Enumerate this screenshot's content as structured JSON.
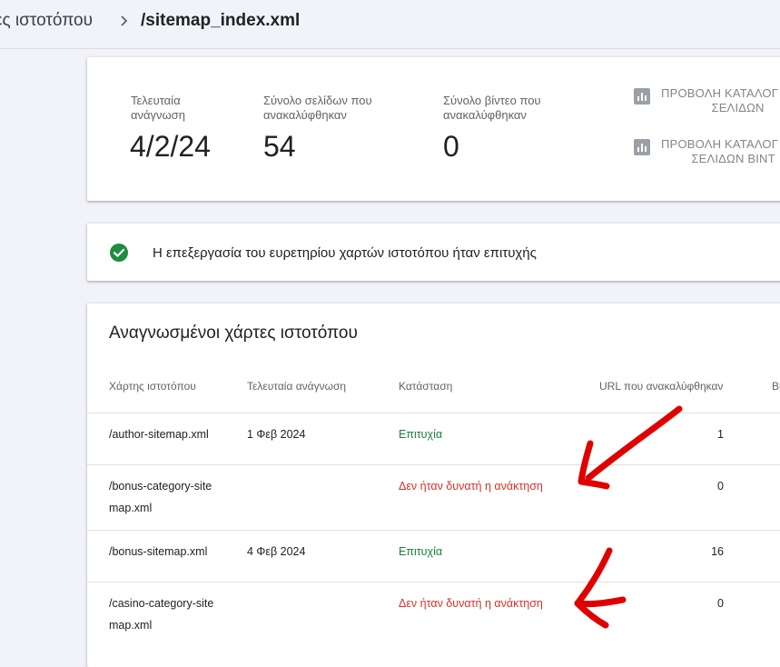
{
  "breadcrumb": {
    "parent": "ες ιστοτόπου",
    "current": "/sitemap_index.xml"
  },
  "stats": {
    "last_read_label_1": "Τελευταία",
    "last_read_label_2": "ανάγνωση",
    "last_read_value": "4/2/24",
    "pages_label_1": "Σύνολο σελίδων που",
    "pages_label_2": "ανακαλύφθηκαν",
    "pages_value": "54",
    "videos_label_1": "Σύνολο βίντεο που",
    "videos_label_2": "ανακαλύφθηκαν",
    "videos_value": "0",
    "link_pages_1": "ΠΡΟΒΟΛΗ ΚΑΤΑΛΟΓ",
    "link_pages_2": "ΣΕΛΙΔΩΝ",
    "link_videos_1": "ΠΡΟΒΟΛΗ ΚΑΤΑΛΟΓ",
    "link_videos_2": "ΣΕΛΙΔΩΝ ΒΙΝΤ"
  },
  "status": {
    "message": "Η επεξεργασία του ευρετηρίου χαρτών ιστοτόπου ήταν επιτυχής"
  },
  "table": {
    "title": "Αναγνωσμένοι χάρτες ιστοτόπου",
    "headers": {
      "sitemap": "Χάρτης ιστοτόπου",
      "last_read": "Τελευταία ανάγνωση",
      "status": "Κατάσταση",
      "urls": "URL που ανακαλύφθηκαν",
      "videos": "Βί"
    },
    "rows": [
      {
        "sitemap_1": "/author-sitemap.xml",
        "sitemap_2": "",
        "last_read": "1 Φεβ 2024",
        "status": "Επιτυχία",
        "urls": "1"
      },
      {
        "sitemap_1": "/bonus-category-site",
        "sitemap_2": "map.xml",
        "last_read": "",
        "status": "Δεν ήταν δυνατή η ανάκτηση",
        "urls": "0"
      },
      {
        "sitemap_1": "/bonus-sitemap.xml",
        "sitemap_2": "",
        "last_read": "4 Φεβ 2024",
        "status": "Επιτυχία",
        "urls": "16"
      },
      {
        "sitemap_1": "/casino-category-site",
        "sitemap_2": "map.xml",
        "last_read": "",
        "status": "Δεν ήταν δυνατή η ανάκτηση",
        "urls": "0"
      }
    ]
  },
  "colors": {
    "success": "#188038",
    "error": "#d93025",
    "annotation": "#e00000"
  }
}
